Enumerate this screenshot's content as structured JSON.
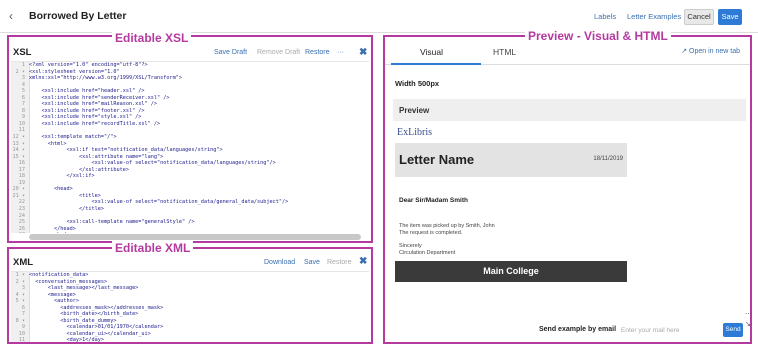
{
  "topbar": {
    "back_icon": "chevron-left-icon",
    "title": "Borrowed By Letter",
    "labels_link": "Labels",
    "examples_link": "Letter Examples",
    "cancel": "Cancel",
    "save": "Save"
  },
  "annotations": {
    "xsl": "Editable XSL",
    "xml": "Editable XML",
    "preview": "Preview - Visual & HTML"
  },
  "xsl_panel": {
    "title": "XSL",
    "actions": [
      "Save Draft",
      "Remove Draft",
      "Restore",
      "···"
    ],
    "collapse_icon": "expand-icon",
    "lines": [
      {
        "n": "1",
        "t": "<?xml version=\"1.0\" encoding=\"utf-8\"?>"
      },
      {
        "n": "2 ▾",
        "t": "<xsl:stylesheet version=\"1.0\""
      },
      {
        "n": "3",
        "t": "xmlns:xsl=\"http://www.w3.org/1999/XSL/Transform\">"
      },
      {
        "n": "4",
        "t": ""
      },
      {
        "n": "5",
        "t": "    <xsl:include href=\"header.xsl\" />"
      },
      {
        "n": "6",
        "t": "    <xsl:include href=\"senderReceiver.xsl\" />"
      },
      {
        "n": "7",
        "t": "    <xsl:include href=\"mailReason.xsl\" />"
      },
      {
        "n": "8",
        "t": "    <xsl:include href=\"footer.xsl\" />"
      },
      {
        "n": "9",
        "t": "    <xsl:include href=\"style.xsl\" />"
      },
      {
        "n": "10",
        "t": "    <xsl:include href=\"recordTitle.xsl\" />"
      },
      {
        "n": "11",
        "t": ""
      },
      {
        "n": "12 ▾",
        "t": "    <xsl:template match=\"/\">"
      },
      {
        "n": "13 ▾",
        "t": "      <html>"
      },
      {
        "n": "14 ▾",
        "t": "            <xsl:if test=\"notification_data/languages/string\">"
      },
      {
        "n": "15 ▾",
        "t": "                <xsl:attribute name=\"lang\">"
      },
      {
        "n": "16",
        "t": "                    <xsl:value-of select=\"notification_data/languages/string\"/>"
      },
      {
        "n": "17",
        "t": "                </xsl:attribute>"
      },
      {
        "n": "18",
        "t": "            </xsl:if>"
      },
      {
        "n": "19",
        "t": ""
      },
      {
        "n": "20 ▾",
        "t": "        <head>"
      },
      {
        "n": "21 ▾",
        "t": "                <title>"
      },
      {
        "n": "22",
        "t": "                    <xsl:value-of select=\"notification_data/general_data/subject\"/>"
      },
      {
        "n": "23",
        "t": "                </title>"
      },
      {
        "n": "24",
        "t": ""
      },
      {
        "n": "25",
        "t": "            <xsl:call-template name=\"generalStyle\" />"
      },
      {
        "n": "26",
        "t": "        </head>"
      },
      {
        "n": "27",
        "t": "        <body>"
      }
    ]
  },
  "xml_panel": {
    "title": "XML",
    "actions": [
      "Download",
      "Save",
      "Restore"
    ],
    "collapse_icon": "expand-icon",
    "lines": [
      {
        "n": "1 ▾",
        "t": "<notification_data>"
      },
      {
        "n": "2 ▾",
        "t": "  <conversation_messages>"
      },
      {
        "n": "3",
        "t": "      <last_message></last_message>"
      },
      {
        "n": "4 ▾",
        "t": "      <message>"
      },
      {
        "n": "5 ▾",
        "t": "        <author>"
      },
      {
        "n": "6",
        "t": "          <addresses_mask></addresses_mask>"
      },
      {
        "n": "7",
        "t": "          <birth_date></birth_date>"
      },
      {
        "n": "8 ▾",
        "t": "          <birth_date_dummy>"
      },
      {
        "n": "9",
        "t": "            <calendar>01/01/1970</calendar>"
      },
      {
        "n": "10",
        "t": "            <calendar_ui></calendar_ui>"
      },
      {
        "n": "11",
        "t": "            <day>1</day>"
      }
    ]
  },
  "preview_panel": {
    "tab_visual": "Visual",
    "tab_html": "HTML",
    "open_new_tab": "Open in new tab",
    "width_label": "Width 500px",
    "preview_label": "Preview",
    "logo": "ExLibris",
    "letter_name": "Letter Name",
    "letter_date": "18/11/2019",
    "salutation": "Dear Sir/Madam   Smith",
    "body_lines": [
      "The item was picked up by Smith, John",
      "The request is completed.",
      "Sincerely",
      "Circulation Department"
    ],
    "college": "Main College",
    "send_label": "Send example by email",
    "mail_placeholder": "Enter your mail here",
    "send_button": "Send"
  },
  "colors": {
    "annotation": "#b43aa0",
    "primary": "#2d7bd6",
    "link": "#3a6fb0"
  }
}
